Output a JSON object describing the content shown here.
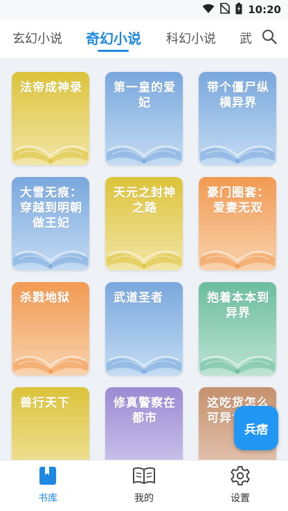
{
  "status_bar": {
    "time": "10:20",
    "icons": [
      "wifi-icon",
      "no-sim-icon",
      "battery-icon"
    ]
  },
  "tabs": [
    {
      "label": "玄幻小说"
    },
    {
      "label": "奇幻小说",
      "active": true
    },
    {
      "label": "科幻小说"
    },
    {
      "label": "武"
    }
  ],
  "search_icon": "search-icon",
  "books": [
    {
      "title": "法帝成神录",
      "color": "yellow"
    },
    {
      "title": "第一皇的爱妃",
      "color": "blue"
    },
    {
      "title": "带个僵尸纵横异界",
      "color": "blue"
    },
    {
      "title": "大雪无痕：穿越到明朝做王妃",
      "color": "blue"
    },
    {
      "title": "天元之封神之路",
      "color": "yellow"
    },
    {
      "title": "豪门圈套：爱妻无双",
      "color": "orange"
    },
    {
      "title": "杀戮地狱",
      "color": "orange"
    },
    {
      "title": "武道圣者",
      "color": "blue"
    },
    {
      "title": "抱着本本到异界",
      "color": "green"
    },
    {
      "title": "兽行天下",
      "color": "yellow"
    },
    {
      "title": "修真警察在都市",
      "color": "purple"
    },
    {
      "title": "这吃货怎么可异世",
      "color": "rose"
    }
  ],
  "fab": {
    "label": "兵痞"
  },
  "bottom_nav": [
    {
      "label": "书库",
      "icon": "bookmark-icon",
      "active": true
    },
    {
      "label": "我的",
      "icon": "open-book-icon"
    },
    {
      "label": "设置",
      "icon": "gear-icon"
    }
  ],
  "colors": {
    "accent": "#1e88e5",
    "yellow": [
      "#dcc33a",
      "#f2e6a8"
    ],
    "blue": [
      "#79a7dd",
      "#c4dcf3"
    ],
    "orange": [
      "#f29a52",
      "#f8d2ad"
    ],
    "green": [
      "#6bbd9e",
      "#bde3d3"
    ],
    "purple": [
      "#9b8bd3",
      "#d3ccee"
    ],
    "rose": [
      "#c5906d",
      "#e8cdbb"
    ]
  }
}
